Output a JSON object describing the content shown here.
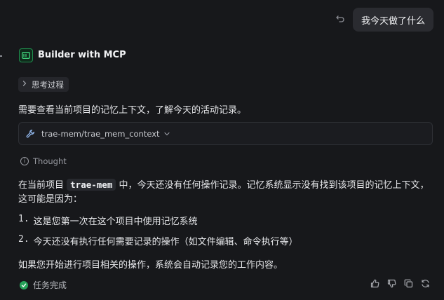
{
  "user_message": "我今天做了什么",
  "agent": {
    "name": "Builder with MCP"
  },
  "thinking_chip": "思考过程",
  "intro_text": "需要查看当前项目的记忆上下文，了解今天的活动记录。",
  "tool_call": "trae-mem/trae_mem_context",
  "thought_label": "Thought",
  "answer": {
    "prefix": "在当前项目 ",
    "project_code": "trae-mem",
    "suffix": " 中，今天还没有任何操作记录。记忆系统显示没有找到该项目的记忆上下文，这可能是因为：",
    "items": [
      {
        "num": "1.",
        "text": "这是您第一次在这个项目中使用记忆系统"
      },
      {
        "num": "2.",
        "text": "今天还没有执行任何需要记录的操作（如文件编辑、命令执行等）"
      }
    ],
    "closing": "如果您开始进行项目相关的操作，系统会自动记录您的工作内容。"
  },
  "status": "任务完成",
  "icons": [
    "undo-icon",
    "terminal-icon",
    "chevron-right-icon",
    "wrench-icon",
    "chevron-down-icon",
    "info-icon",
    "check-circle-icon",
    "thumbs-up-icon",
    "thumbs-down-icon",
    "copy-icon",
    "refresh-icon"
  ],
  "colors": {
    "background": "#17181b",
    "success": "#27a35a",
    "agent_accent": "#1f8f4e",
    "bubble": "#2a2b30"
  }
}
